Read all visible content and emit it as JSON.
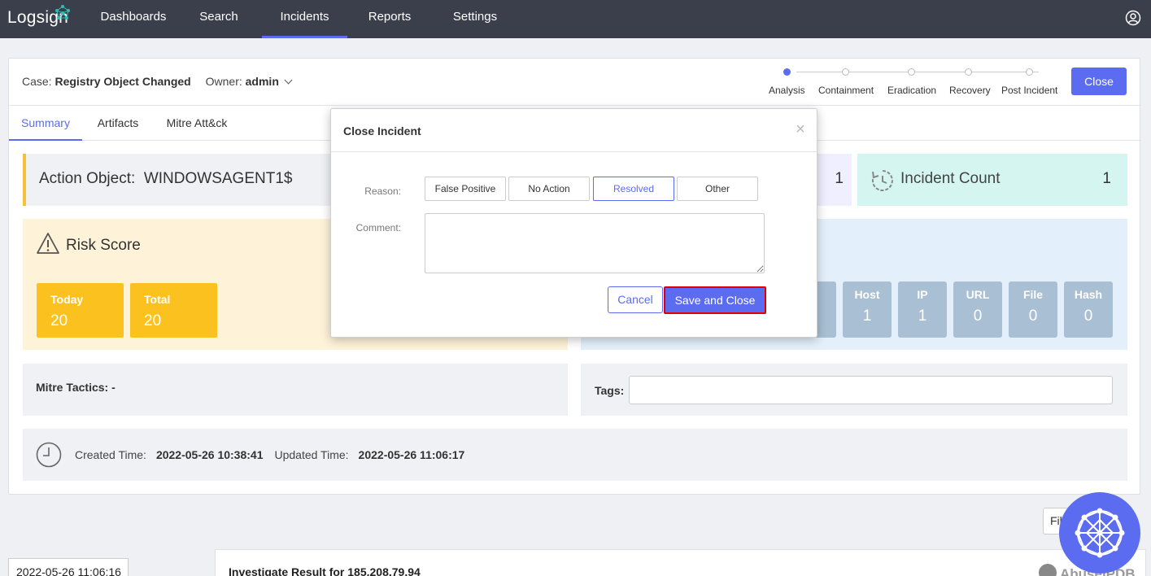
{
  "nav": {
    "logo": "Logsign",
    "items": [
      "Dashboards",
      "Search",
      "Incidents",
      "Reports",
      "Settings"
    ],
    "active": "Incidents"
  },
  "case": {
    "case_label": "Case:",
    "case_name": "Registry Object Changed",
    "owner_label": "Owner:",
    "owner_value": "admin",
    "close_label": "Close",
    "stages": [
      "Analysis",
      "Containment",
      "Eradication",
      "Recovery",
      "Post Incident"
    ],
    "current_stage": "Analysis"
  },
  "tabs": [
    "Summary",
    "Artifacts",
    "Mitre Att&ck"
  ],
  "summary": {
    "action_object_label": "Action Object:",
    "action_object_value": "WINDOWSAGENT1$",
    "hidden_panel_value": "1",
    "incident_count_label": "Incident Count",
    "incident_count_value": "1",
    "risk_score_label": "Risk Score",
    "risk_today_label": "Today",
    "risk_today_value": "20",
    "risk_total_label": "Total",
    "risk_total_value": "20",
    "artifacts": [
      {
        "label": "er",
        "value": "1"
      },
      {
        "label": "Host",
        "value": "1"
      },
      {
        "label": "IP",
        "value": "1"
      },
      {
        "label": "URL",
        "value": "0"
      },
      {
        "label": "File",
        "value": "0"
      },
      {
        "label": "Hash",
        "value": "0"
      }
    ],
    "mitre_tactics": "Mitre Tactics: -",
    "tags_label": "Tags:",
    "created_label": "Created Time:",
    "created_value": "2022-05-26 10:38:41",
    "updated_label": "Updated Time:",
    "updated_value": "2022-05-26 11:06:17"
  },
  "below": {
    "filter_label": "Fil",
    "timeline_date": "2022-05-26 11:06:16",
    "investigate_title": "Investigate Result for 185.208.79.94",
    "abuse_logo": "AbuseIPDB"
  },
  "modal": {
    "title": "Close Incident",
    "close_glyph": "×",
    "reason_label": "Reason:",
    "reasons": [
      "False Positive",
      "No Action",
      "Resolved",
      "Other"
    ],
    "selected_reason": "Resolved",
    "comment_label": "Comment:",
    "cancel_label": "Cancel",
    "save_label": "Save and Close"
  },
  "colors": {
    "accent": "#5b6cf0",
    "nav_bg": "#3b3f4c",
    "highlight_border": "#e00000"
  }
}
